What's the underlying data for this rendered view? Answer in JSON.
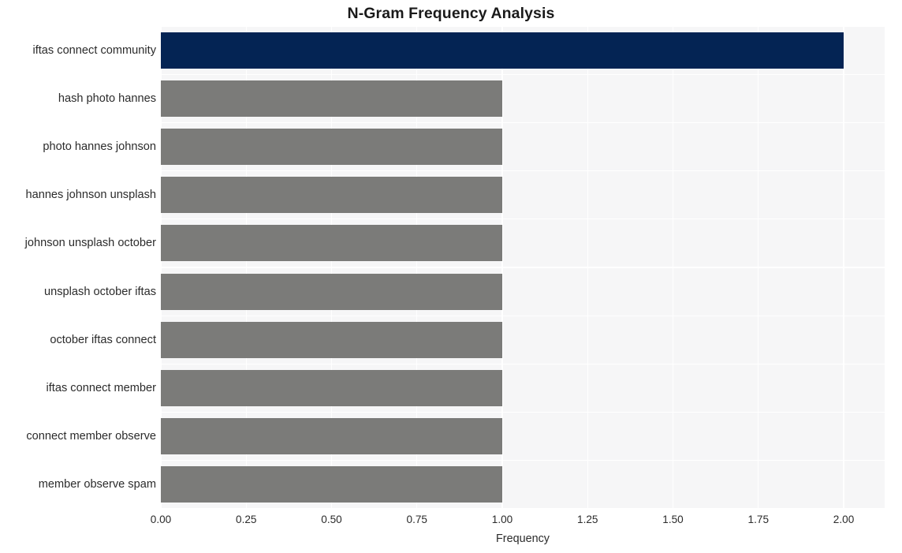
{
  "chart_data": {
    "type": "bar",
    "orientation": "horizontal",
    "title": "N-Gram Frequency Analysis",
    "xlabel": "Frequency",
    "ylabel": "",
    "xlim": [
      0,
      2.12
    ],
    "xticks": [
      "0.00",
      "0.25",
      "0.50",
      "0.75",
      "1.00",
      "1.25",
      "1.50",
      "1.75",
      "2.00"
    ],
    "xtick_values": [
      0,
      0.25,
      0.5,
      0.75,
      1.0,
      1.25,
      1.5,
      1.75,
      2.0
    ],
    "grid": true,
    "legend": "none",
    "categories": [
      "iftas connect community",
      "hash photo hannes",
      "photo hannes johnson",
      "hannes johnson unsplash",
      "johnson unsplash october",
      "unsplash october iftas",
      "october iftas connect",
      "iftas connect member",
      "connect member observe",
      "member observe spam"
    ],
    "values": [
      2,
      1,
      1,
      1,
      1,
      1,
      1,
      1,
      1,
      1
    ],
    "bar_colors": [
      "#042454",
      "#7b7b79",
      "#7b7b79",
      "#7b7b79",
      "#7b7b79",
      "#7b7b79",
      "#7b7b79",
      "#7b7b79",
      "#7b7b79",
      "#7b7b79"
    ],
    "highlight_color": "#042454",
    "default_color": "#7b7b79",
    "plot_background": "#f6f6f7",
    "grid_color": "#ffffff",
    "figure_background": "#ffffff"
  }
}
